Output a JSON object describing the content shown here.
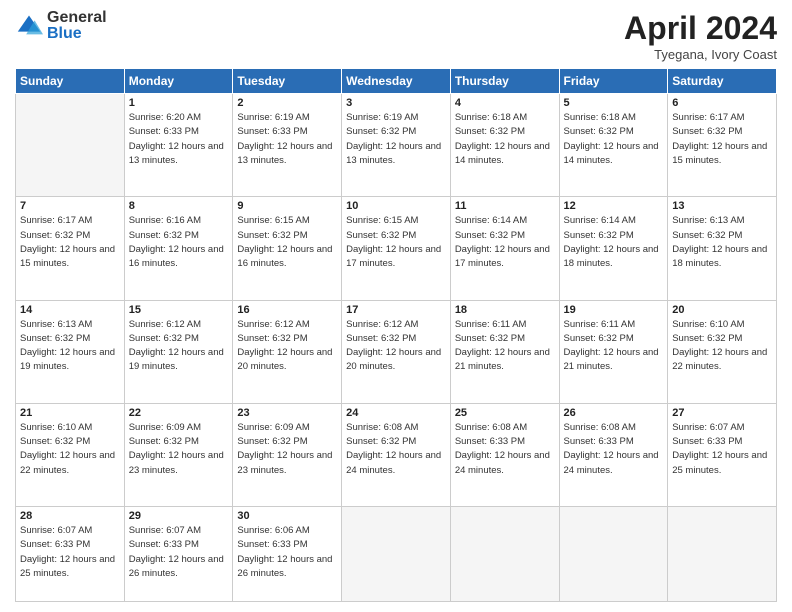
{
  "header": {
    "logo_general": "General",
    "logo_blue": "Blue",
    "month_title": "April 2024",
    "subtitle": "Tyegana, Ivory Coast"
  },
  "days_of_week": [
    "Sunday",
    "Monday",
    "Tuesday",
    "Wednesday",
    "Thursday",
    "Friday",
    "Saturday"
  ],
  "weeks": [
    [
      {
        "day": "",
        "empty": true
      },
      {
        "day": "1",
        "sunrise": "6:20 AM",
        "sunset": "6:33 PM",
        "daylight": "12 hours and 13 minutes."
      },
      {
        "day": "2",
        "sunrise": "6:19 AM",
        "sunset": "6:33 PM",
        "daylight": "12 hours and 13 minutes."
      },
      {
        "day": "3",
        "sunrise": "6:19 AM",
        "sunset": "6:32 PM",
        "daylight": "12 hours and 13 minutes."
      },
      {
        "day": "4",
        "sunrise": "6:18 AM",
        "sunset": "6:32 PM",
        "daylight": "12 hours and 14 minutes."
      },
      {
        "day": "5",
        "sunrise": "6:18 AM",
        "sunset": "6:32 PM",
        "daylight": "12 hours and 14 minutes."
      },
      {
        "day": "6",
        "sunrise": "6:17 AM",
        "sunset": "6:32 PM",
        "daylight": "12 hours and 15 minutes."
      }
    ],
    [
      {
        "day": "7",
        "sunrise": "6:17 AM",
        "sunset": "6:32 PM",
        "daylight": "12 hours and 15 minutes."
      },
      {
        "day": "8",
        "sunrise": "6:16 AM",
        "sunset": "6:32 PM",
        "daylight": "12 hours and 16 minutes."
      },
      {
        "day": "9",
        "sunrise": "6:15 AM",
        "sunset": "6:32 PM",
        "daylight": "12 hours and 16 minutes."
      },
      {
        "day": "10",
        "sunrise": "6:15 AM",
        "sunset": "6:32 PM",
        "daylight": "12 hours and 17 minutes."
      },
      {
        "day": "11",
        "sunrise": "6:14 AM",
        "sunset": "6:32 PM",
        "daylight": "12 hours and 17 minutes."
      },
      {
        "day": "12",
        "sunrise": "6:14 AM",
        "sunset": "6:32 PM",
        "daylight": "12 hours and 18 minutes."
      },
      {
        "day": "13",
        "sunrise": "6:13 AM",
        "sunset": "6:32 PM",
        "daylight": "12 hours and 18 minutes."
      }
    ],
    [
      {
        "day": "14",
        "sunrise": "6:13 AM",
        "sunset": "6:32 PM",
        "daylight": "12 hours and 19 minutes."
      },
      {
        "day": "15",
        "sunrise": "6:12 AM",
        "sunset": "6:32 PM",
        "daylight": "12 hours and 19 minutes."
      },
      {
        "day": "16",
        "sunrise": "6:12 AM",
        "sunset": "6:32 PM",
        "daylight": "12 hours and 20 minutes."
      },
      {
        "day": "17",
        "sunrise": "6:12 AM",
        "sunset": "6:32 PM",
        "daylight": "12 hours and 20 minutes."
      },
      {
        "day": "18",
        "sunrise": "6:11 AM",
        "sunset": "6:32 PM",
        "daylight": "12 hours and 21 minutes."
      },
      {
        "day": "19",
        "sunrise": "6:11 AM",
        "sunset": "6:32 PM",
        "daylight": "12 hours and 21 minutes."
      },
      {
        "day": "20",
        "sunrise": "6:10 AM",
        "sunset": "6:32 PM",
        "daylight": "12 hours and 22 minutes."
      }
    ],
    [
      {
        "day": "21",
        "sunrise": "6:10 AM",
        "sunset": "6:32 PM",
        "daylight": "12 hours and 22 minutes."
      },
      {
        "day": "22",
        "sunrise": "6:09 AM",
        "sunset": "6:32 PM",
        "daylight": "12 hours and 23 minutes."
      },
      {
        "day": "23",
        "sunrise": "6:09 AM",
        "sunset": "6:32 PM",
        "daylight": "12 hours and 23 minutes."
      },
      {
        "day": "24",
        "sunrise": "6:08 AM",
        "sunset": "6:32 PM",
        "daylight": "12 hours and 24 minutes."
      },
      {
        "day": "25",
        "sunrise": "6:08 AM",
        "sunset": "6:33 PM",
        "daylight": "12 hours and 24 minutes."
      },
      {
        "day": "26",
        "sunrise": "6:08 AM",
        "sunset": "6:33 PM",
        "daylight": "12 hours and 24 minutes."
      },
      {
        "day": "27",
        "sunrise": "6:07 AM",
        "sunset": "6:33 PM",
        "daylight": "12 hours and 25 minutes."
      }
    ],
    [
      {
        "day": "28",
        "sunrise": "6:07 AM",
        "sunset": "6:33 PM",
        "daylight": "12 hours and 25 minutes."
      },
      {
        "day": "29",
        "sunrise": "6:07 AM",
        "sunset": "6:33 PM",
        "daylight": "12 hours and 26 minutes."
      },
      {
        "day": "30",
        "sunrise": "6:06 AM",
        "sunset": "6:33 PM",
        "daylight": "12 hours and 26 minutes."
      },
      {
        "day": "",
        "empty": true
      },
      {
        "day": "",
        "empty": true
      },
      {
        "day": "",
        "empty": true
      },
      {
        "day": "",
        "empty": true
      }
    ]
  ],
  "labels": {
    "sunrise": "Sunrise:",
    "sunset": "Sunset:",
    "daylight": "Daylight:"
  }
}
